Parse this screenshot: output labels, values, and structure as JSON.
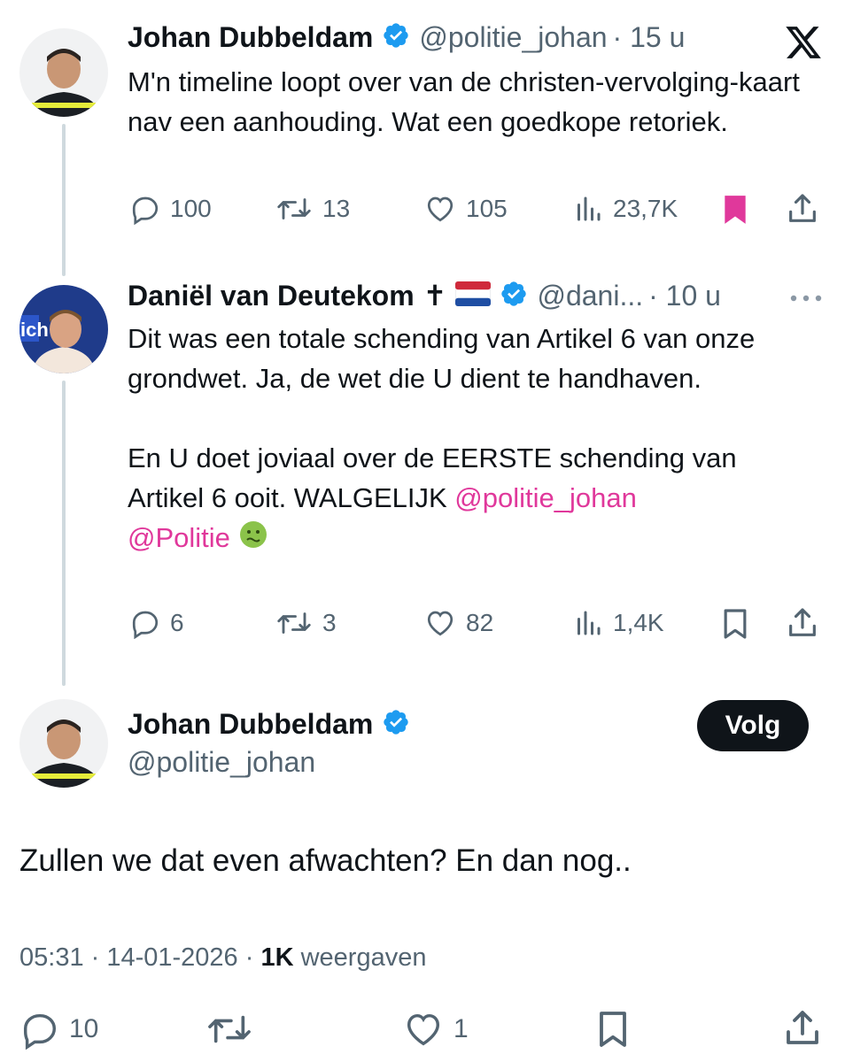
{
  "colors": {
    "accent_pink": "#e0389b",
    "verified_blue": "#1d9bf0",
    "muted": "#536471"
  },
  "tweet1": {
    "name": "Johan Dubbeldam",
    "handle": "@politie_johan",
    "time": "· 15 u",
    "text": "M'n timeline loopt over van de christen-vervolging-kaart nav een aanhouding. Wat een goedkope retoriek.",
    "replies": "100",
    "retweets": "13",
    "likes": "105",
    "views": "23,7K",
    "bookmarked": true,
    "icons": [
      "x-logo-icon",
      "verified-badge-icon",
      "reply-icon",
      "retweet-icon",
      "like-icon",
      "views-icon",
      "bookmark-icon",
      "share-icon"
    ]
  },
  "tweet2": {
    "name": "Daniël van Deutekom",
    "name_suffix": "✝",
    "flag": "netherlands-flag-icon",
    "handle": "@dani...",
    "time": "· 10 u",
    "text_p1": "Dit was een totale schending van Artikel 6 van onze grondwet. Ja, de wet die U dient te handhaven.",
    "text_p2_before": "En U doet joviaal over de EERSTE schending van Artikel 6 ooit. WALGELIJK ",
    "mention1": "@politie_johan",
    "mention2": "@Politie",
    "emoji": "🤢",
    "replies": "6",
    "retweets": "3",
    "likes": "82",
    "views": "1,4K"
  },
  "tweet3": {
    "name": "Johan Dubbeldam",
    "handle": "@politie_johan",
    "follow_label": "Volg",
    "text": "Zullen we dat even afwachten? En dan nog..",
    "timestamp": "05:31 · 14-01-2026 · ",
    "views_count": "1K",
    "views_label": " weergaven",
    "replies": "10",
    "retweets": "",
    "likes": "1"
  }
}
